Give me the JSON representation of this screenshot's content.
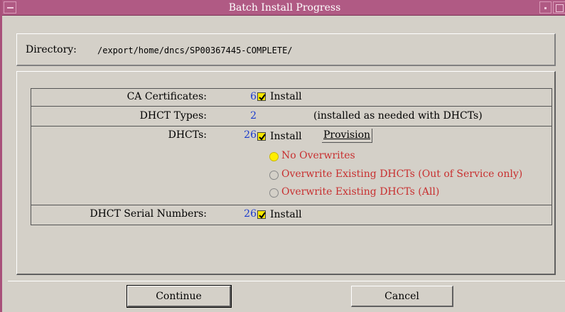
{
  "window": {
    "title": "Batch Install Progress"
  },
  "directory": {
    "label": "Directory:",
    "path": "/export/home/dncs/SP00367445-COMPLETE/"
  },
  "rows": {
    "ca": {
      "label": "CA Certificates:",
      "count": "6",
      "install_label": "Install",
      "checked": true
    },
    "types": {
      "label": "DHCT Types:",
      "count": "2",
      "note": "(installed as needed with DHCTs)"
    },
    "dhcts": {
      "label": "DHCTs:",
      "count": "26",
      "install_label": "Install",
      "checked": true,
      "provision_label": "Provision",
      "options": [
        {
          "label": "No Overwrites",
          "selected": true
        },
        {
          "label": "Overwrite Existing DHCTs (Out of Service only)",
          "selected": false
        },
        {
          "label": "Overwrite Existing DHCTs (All)",
          "selected": false
        }
      ]
    },
    "serials": {
      "label": "DHCT Serial Numbers:",
      "count": "26",
      "install_label": "Install",
      "checked": true
    }
  },
  "buttons": {
    "continue_label": "Continue",
    "cancel_label": "Cancel"
  },
  "colors": {
    "title_bar": "#b05a84",
    "count_text": "#1c3ccc",
    "option_text": "#c83030",
    "checkbox": "#f4e600",
    "radio_selected": "#ffee00"
  }
}
